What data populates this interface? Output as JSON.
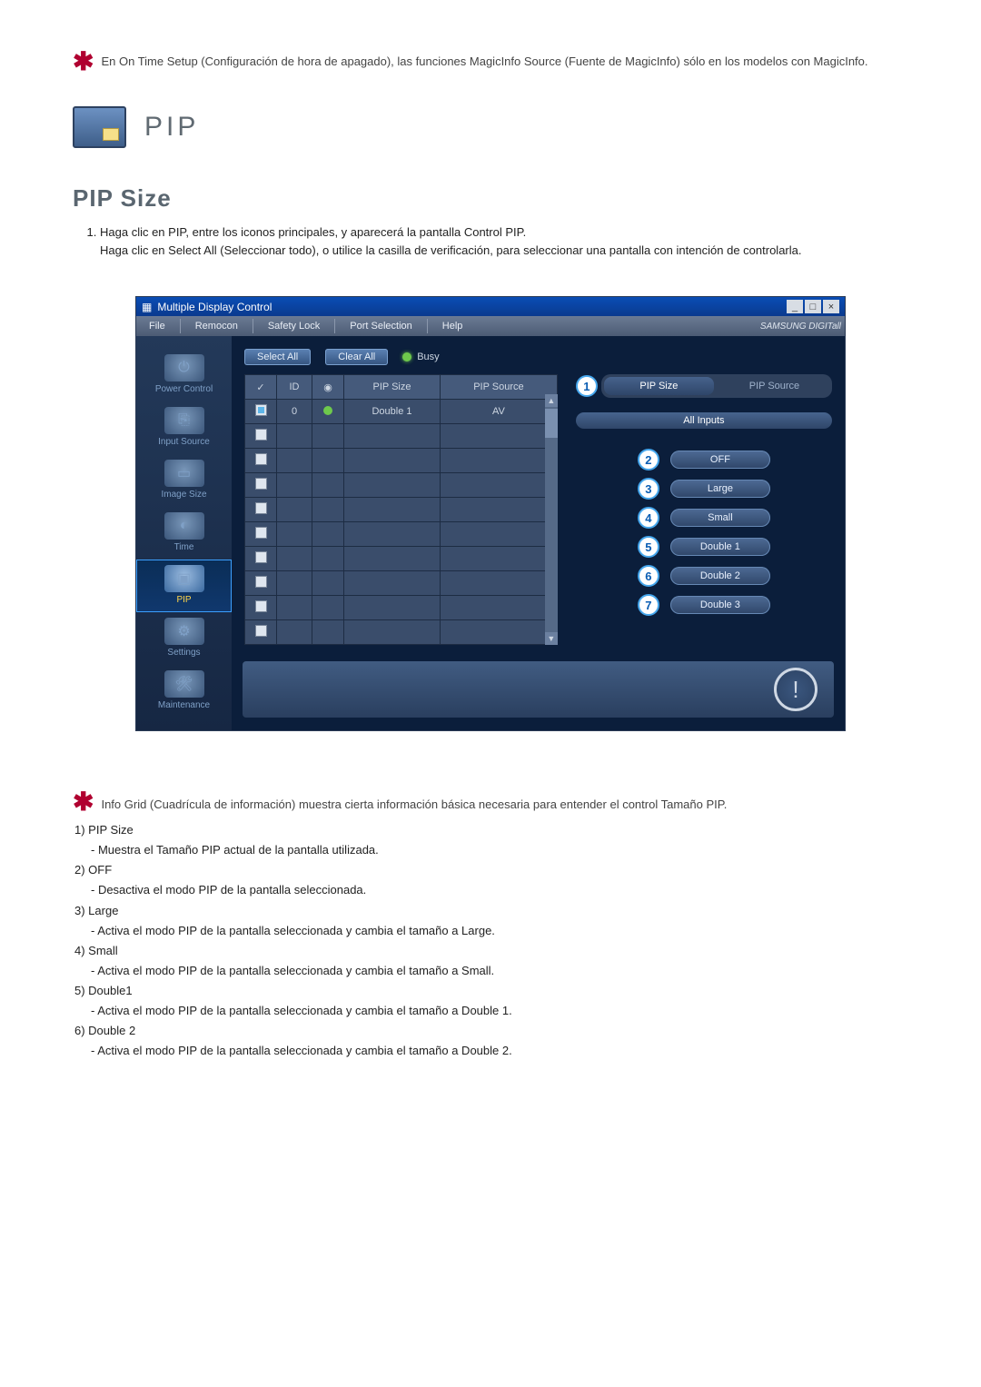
{
  "top_note": "En On Time Setup (Configuración de hora de apagado), las funciones MagicInfo Source (Fuente de MagicInfo) sólo en los modelos con MagicInfo.",
  "pip_title": "PIP",
  "section_title": "PIP Size",
  "steps": {
    "s1a": "Haga clic en PIP, entre los iconos principales, y aparecerá la pantalla Control PIP.",
    "s1b": "Haga clic en Select All (Seleccionar todo), o utilice la casilla de verificación, para seleccionar una pantalla con intención de controlarla."
  },
  "app": {
    "title": "Multiple Display Control",
    "menu": {
      "file": "File",
      "remocon": "Remocon",
      "safety": "Safety Lock",
      "port": "Port Selection",
      "help": "Help"
    },
    "brand": "SAMSUNG DIGITall",
    "sidebar": {
      "power": "Power Control",
      "input": "Input Source",
      "image": "Image Size",
      "time": "Time",
      "pip": "PIP",
      "settings": "Settings",
      "maint": "Maintenance"
    },
    "toolbar": {
      "select_all": "Select All",
      "clear_all": "Clear All",
      "busy": "Busy"
    },
    "grid_headers": {
      "chk": "✓",
      "id": "ID",
      "status": "◉",
      "pipsize": "PIP Size",
      "pipsource": "PIP Source"
    },
    "grid_row": {
      "id": "0",
      "pipsize": "Double 1",
      "pipsource": "AV"
    },
    "tabs": {
      "size": "PIP Size",
      "source": "PIP Source"
    },
    "allinputs": "All Inputs",
    "size_buttons": {
      "off": "OFF",
      "large": "Large",
      "small": "Small",
      "d1": "Double 1",
      "d2": "Double 2",
      "d3": "Double 3"
    },
    "callouts": {
      "c1": "1",
      "c2": "2",
      "c3": "3",
      "c4": "4",
      "c5": "5",
      "c6": "6",
      "c7": "7"
    }
  },
  "legend": {
    "intro": "Info Grid (Cuadrícula de información) muestra cierta información básica necesaria para entender el control Tamaño PIP.",
    "i1_t": "1)  PIP Size",
    "i1_d": "- Muestra el Tamaño PIP actual de la pantalla utilizada.",
    "i2_t": "2)  OFF",
    "i2_d": "- Desactiva el modo PIP de la pantalla seleccionada.",
    "i3_t": "3)  Large",
    "i3_d": "- Activa el modo PIP de la pantalla seleccionada y cambia el tamaño a Large.",
    "i4_t": "4)  Small",
    "i4_d": "- Activa el modo PIP de la pantalla seleccionada y cambia el tamaño a Small.",
    "i5_t": "5)  Double1",
    "i5_d": "- Activa el modo PIP de la pantalla seleccionada y cambia el tamaño a Double 1.",
    "i6_t": "6)  Double 2",
    "i6_d": "- Activa el modo PIP de la pantalla seleccionada y cambia el tamaño a Double 2."
  }
}
